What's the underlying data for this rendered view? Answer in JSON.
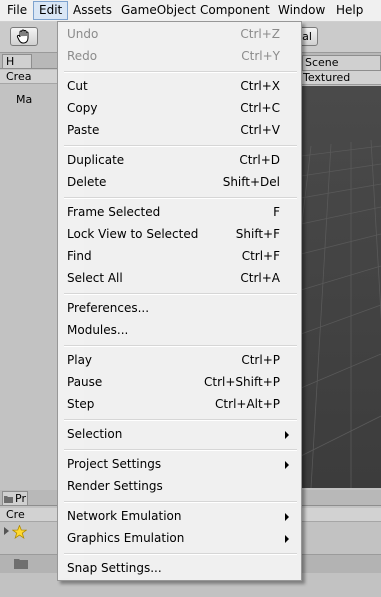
{
  "menubar": {
    "items": [
      "File",
      "Edit",
      "Assets",
      "GameObject",
      "Component",
      "Window",
      "Help"
    ]
  },
  "toolbar": {
    "hand_icon": "hand-icon",
    "pivot_fragment": "al"
  },
  "hierarchy": {
    "tab_label": "H",
    "create_label": "Crea",
    "item_label": "Ma"
  },
  "scene": {
    "tab_label": "Scene",
    "mode_label": "Textured"
  },
  "project": {
    "tab_label": "Pr",
    "create_label": "Cre"
  },
  "edit_menu": {
    "undo": {
      "label": "Undo",
      "shortcut": "Ctrl+Z"
    },
    "redo": {
      "label": "Redo",
      "shortcut": "Ctrl+Y"
    },
    "cut": {
      "label": "Cut",
      "shortcut": "Ctrl+X"
    },
    "copy": {
      "label": "Copy",
      "shortcut": "Ctrl+C"
    },
    "paste": {
      "label": "Paste",
      "shortcut": "Ctrl+V"
    },
    "duplicate": {
      "label": "Duplicate",
      "shortcut": "Ctrl+D"
    },
    "delete": {
      "label": "Delete",
      "shortcut": "Shift+Del"
    },
    "frame_selected": {
      "label": "Frame Selected",
      "shortcut": "F"
    },
    "lock_view": {
      "label": "Lock View to Selected",
      "shortcut": "Shift+F"
    },
    "find": {
      "label": "Find",
      "shortcut": "Ctrl+F"
    },
    "select_all": {
      "label": "Select All",
      "shortcut": "Ctrl+A"
    },
    "preferences": {
      "label": "Preferences..."
    },
    "modules": {
      "label": "Modules..."
    },
    "play": {
      "label": "Play",
      "shortcut": "Ctrl+P"
    },
    "pause": {
      "label": "Pause",
      "shortcut": "Ctrl+Shift+P"
    },
    "step": {
      "label": "Step",
      "shortcut": "Ctrl+Alt+P"
    },
    "selection": {
      "label": "Selection"
    },
    "project_settings": {
      "label": "Project Settings"
    },
    "render_settings": {
      "label": "Render Settings"
    },
    "network_emulation": {
      "label": "Network Emulation"
    },
    "graphics_emulation": {
      "label": "Graphics Emulation"
    },
    "snap_settings": {
      "label": "Snap Settings..."
    }
  },
  "colors": {
    "menu_bg": "#f0f0f0",
    "active_menu_highlight": "#d9e6f5",
    "disabled_text": "#8b8b8b",
    "scene_bg": "#464646"
  }
}
